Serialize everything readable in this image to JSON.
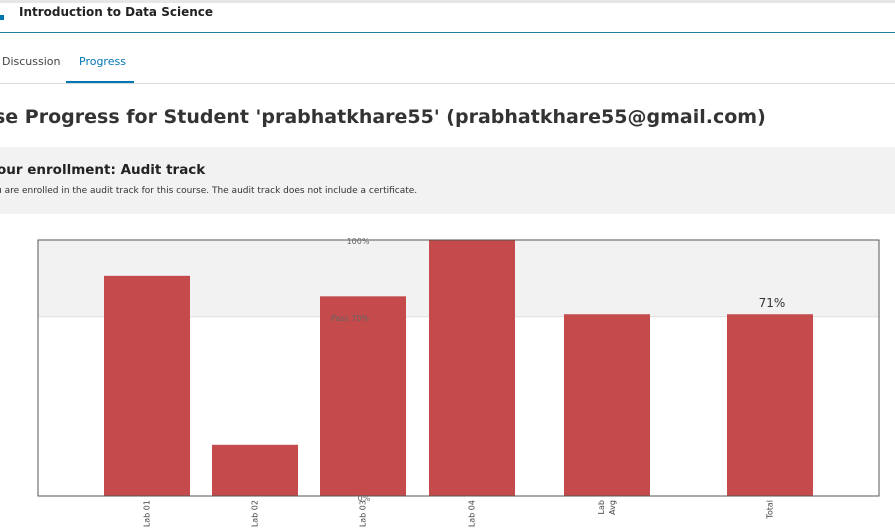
{
  "header": {
    "course_title": "Introduction to Data Science"
  },
  "tabs": [
    {
      "label": "Discussion",
      "active": false
    },
    {
      "label": "Progress",
      "active": true
    }
  ],
  "page_title": "se Progress for Student 'prabhatkhare55' (prabhatkhare55@gmail.com)",
  "enrollment": {
    "title": "our enrollment: Audit track",
    "text": "u are enrolled in the audit track for this course. The audit track does not include a certificate."
  },
  "chart_data": {
    "type": "bar",
    "categories": [
      "Lab 01",
      "Lab 02",
      "Lab 03",
      "Lab 04",
      "Lab Avg",
      "Total"
    ],
    "values": [
      86,
      20,
      78,
      100,
      71,
      71
    ],
    "ylim": [
      0,
      100
    ],
    "pass_threshold": 70,
    "labels": {
      "top": "100%",
      "pass": "Pass 70%",
      "bottom": "0%",
      "total": "71%"
    },
    "bar_color": "#c44a4b",
    "pass_band_color": "#f2f2f2"
  }
}
